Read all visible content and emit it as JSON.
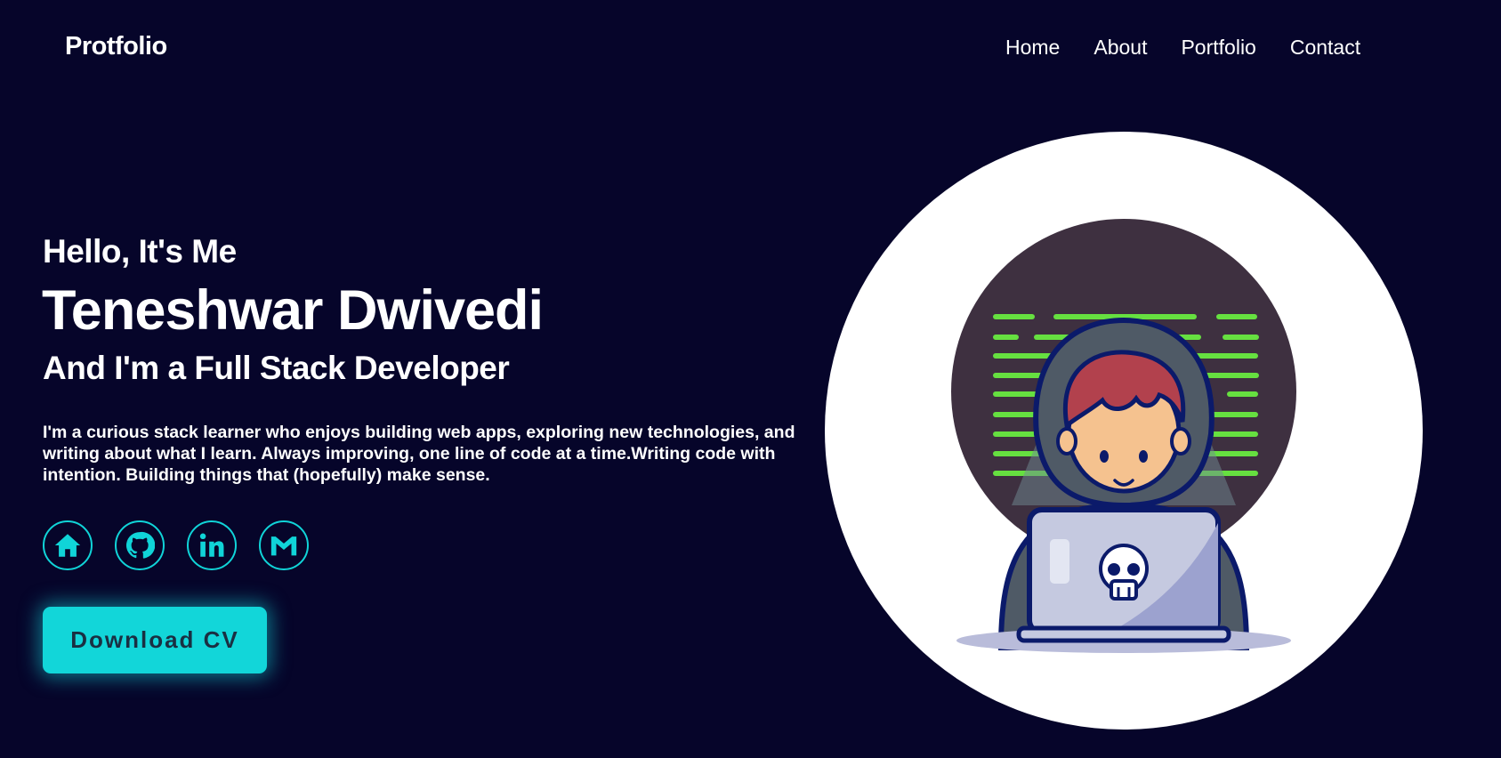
{
  "header": {
    "logo": "Protfolio",
    "nav": [
      "Home",
      "About",
      "Portfolio",
      "Contact"
    ]
  },
  "hero": {
    "greeting": "Hello, It's Me",
    "name": "Teneshwar Dwivedi",
    "role": "And I'm a Full Stack Developer",
    "bio": "I'm a curious stack learner who enjoys building web apps, exploring new technologies, and writing about what I learn. Always improving, one line of code at a time.Writing code with intention. Building things that (hopefully) make sense.",
    "cv_button": "Download CV"
  },
  "socials": [
    {
      "name": "home-icon"
    },
    {
      "name": "github-icon"
    },
    {
      "name": "linkedin-icon"
    },
    {
      "name": "gmail-icon"
    }
  ],
  "colors": {
    "background": "#06052a",
    "accent": "#12d6d9",
    "text": "#ffffff"
  }
}
